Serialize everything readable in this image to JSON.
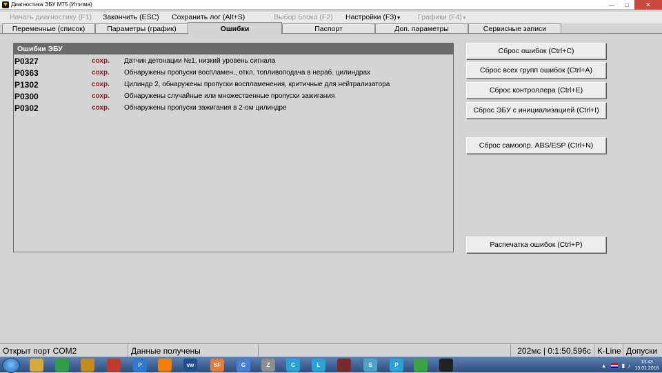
{
  "window": {
    "title": "Диагностика ЭБУ М75 (Итэлма)"
  },
  "menu": [
    {
      "label": "Начать диагностику (F1)",
      "enabled": false
    },
    {
      "label": "Закончить (ESC)",
      "enabled": true
    },
    {
      "label": "Сохранить лог (Alt+S)",
      "enabled": true
    },
    {
      "label": "Выбор блока (F2)",
      "enabled": false
    },
    {
      "label": "Настройки (F3)",
      "enabled": true,
      "dropdown": true
    },
    {
      "label": "Графики (F4)",
      "enabled": false,
      "dropdown": true
    }
  ],
  "tabs": [
    {
      "label": "Переменные (список)",
      "active": false
    },
    {
      "label": "Параметры (график)",
      "active": false
    },
    {
      "label": "Ошибки",
      "active": true
    },
    {
      "label": "Паспорт",
      "active": false
    },
    {
      "label": "Доп. параметры",
      "active": false
    },
    {
      "label": "Сервисные записи",
      "active": false
    }
  ],
  "errors_panel": {
    "title": "Ошибки ЭБУ",
    "rows": [
      {
        "code": "P0327",
        "status": "сохр.",
        "description": "Датчик детонации №1, низкий уровень сигнала"
      },
      {
        "code": "P0363",
        "status": "сохр.",
        "description": "Обнаружены пропуски воспламен., откл. топливоподача в нераб. цилиндрах"
      },
      {
        "code": "P1302",
        "status": "сохр.",
        "description": "Цилиндр 2, обнаружены пропуски воспламенения, критичные для нейтрализатора"
      },
      {
        "code": "P0300",
        "status": "сохр.",
        "description": "Обнаружены случайные или множественные пропуски зажигания"
      },
      {
        "code": "P0302",
        "status": "сохр.",
        "description": "Обнаружены пропуски зажигания в 2-ом цилиндре"
      }
    ]
  },
  "buttons": {
    "reset_errors": "Сброс ошибок (Ctrl+C)",
    "reset_all_groups": "Сброс всех групп ошибок (Ctrl+A)",
    "reset_controller": "Сброс контроллера (Ctrl+E)",
    "reset_ecu_init": "Сброс ЭБУ с инициализацией (Ctrl+I)",
    "reset_abs_esp": "Сброс самоопр. ABS/ESP (Ctrl+N)",
    "print_errors": "Распечатка ошибок (Ctrl+P)"
  },
  "status": {
    "port": "Открыт порт COM2",
    "data": "Данные получены",
    "timing": "202мс | 0:1:50,596с",
    "protocol": "K-Line",
    "extra": "Допуски"
  },
  "taskbar": {
    "apps": [
      {
        "icon": "file-explorer-icon",
        "color": "#d9a93a"
      },
      {
        "icon": "chrome-icon",
        "color": "#2f9e44"
      },
      {
        "icon": "mascot-icon",
        "color": "#c58b1a"
      },
      {
        "icon": "red-app-icon",
        "color": "#c0392b"
      },
      {
        "icon": "p-app-icon",
        "color": "#2b7bd1",
        "text": "P"
      },
      {
        "icon": "blogger-icon",
        "color": "#f57d00"
      },
      {
        "icon": "vw-forum-icon",
        "color": "#1d4f91",
        "text": "vw"
      },
      {
        "icon": "sf-icon",
        "color": "#e87a39",
        "text": "SF"
      },
      {
        "icon": "translate-icon",
        "color": "#4a7fd6",
        "text": "G"
      },
      {
        "icon": "z-app-icon",
        "color": "#8e8e8e",
        "text": "Z"
      },
      {
        "icon": "c-app-icon",
        "color": "#2aa2d6",
        "text": "C"
      },
      {
        "icon": "l-app-icon",
        "color": "#2aa2d6",
        "text": "L"
      },
      {
        "icon": "red-square-icon",
        "color": "#7a2a2a"
      },
      {
        "icon": "s-app-icon",
        "color": "#4aa3c9",
        "text": "S"
      },
      {
        "icon": "p-app-2-icon",
        "color": "#2aa2d6",
        "text": "P"
      },
      {
        "icon": "utorrent-icon",
        "color": "#3aa345"
      },
      {
        "icon": "diagnostic-app-icon",
        "color": "#222222"
      }
    ],
    "time": "13:43",
    "date": "13.01.2016"
  }
}
